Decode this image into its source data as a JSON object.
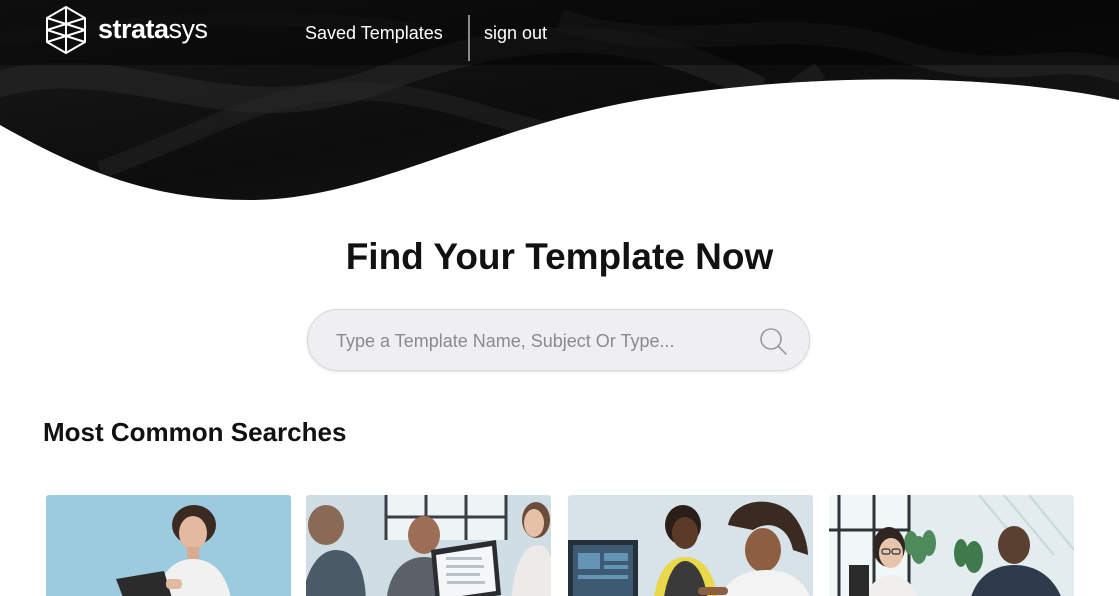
{
  "brand": {
    "name_bold": "strata",
    "name_light": "sys"
  },
  "nav": {
    "saved_templates": "Saved Templates",
    "sign_out": "sign out"
  },
  "main": {
    "headline": "Find Your Template Now",
    "search": {
      "placeholder": "Type a Template Name, Subject Or Type...",
      "value": ""
    },
    "section_title": "Most Common Searches"
  },
  "cards": [
    {
      "image": "woman-holding-clipboard-photo"
    },
    {
      "image": "team-meeting-with-laptop-photo"
    },
    {
      "image": "colleagues-looking-at-monitor-photo"
    },
    {
      "image": "office-conversation-photo"
    }
  ],
  "colors": {
    "header_bg": "#0b0b0b",
    "text_dark": "#111111",
    "search_bg": "#efeef0"
  }
}
